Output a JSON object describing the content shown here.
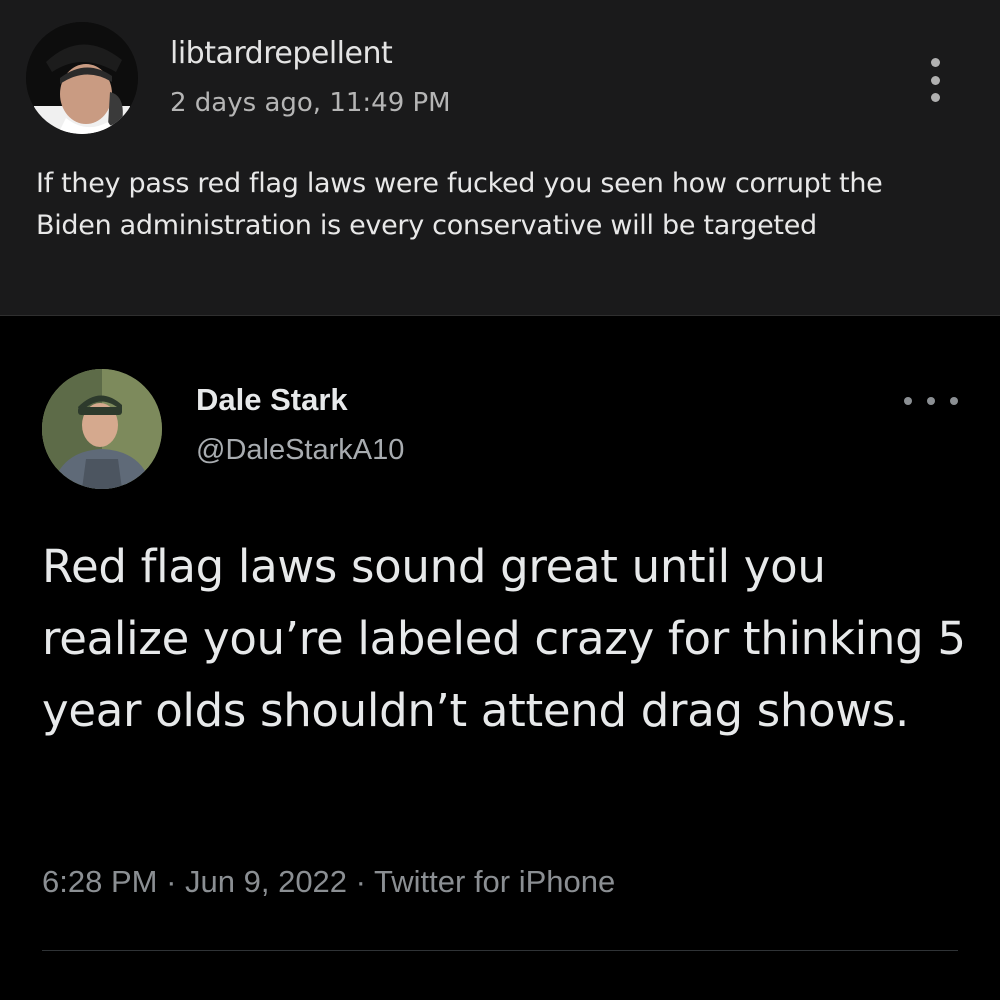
{
  "post": {
    "username": "libtardrepellent",
    "timestamp": "2 days ago, 11:49 PM",
    "body": "If they pass red flag laws were fucked you seen how corrupt the Biden administration is every conservative will be targeted",
    "menu_icon": "vertical-ellipsis-icon"
  },
  "tweet": {
    "name": "Dale Stark",
    "handle": "@DaleStarkA10",
    "text": "Red flag laws sound great until you realize you’re labeled crazy for thinking 5 year olds shouldn’t attend drag shows.",
    "time": "6:28 PM",
    "separator": " · ",
    "date": "Jun 9, 2022",
    "source": "Twitter for iPhone",
    "more_icon": "horizontal-ellipsis-icon"
  },
  "colors": {
    "post_bg": "#1a1a1b",
    "tweet_bg": "#000000",
    "primary_text": "#e7e9ea",
    "secondary_text": "#8b8f93"
  }
}
